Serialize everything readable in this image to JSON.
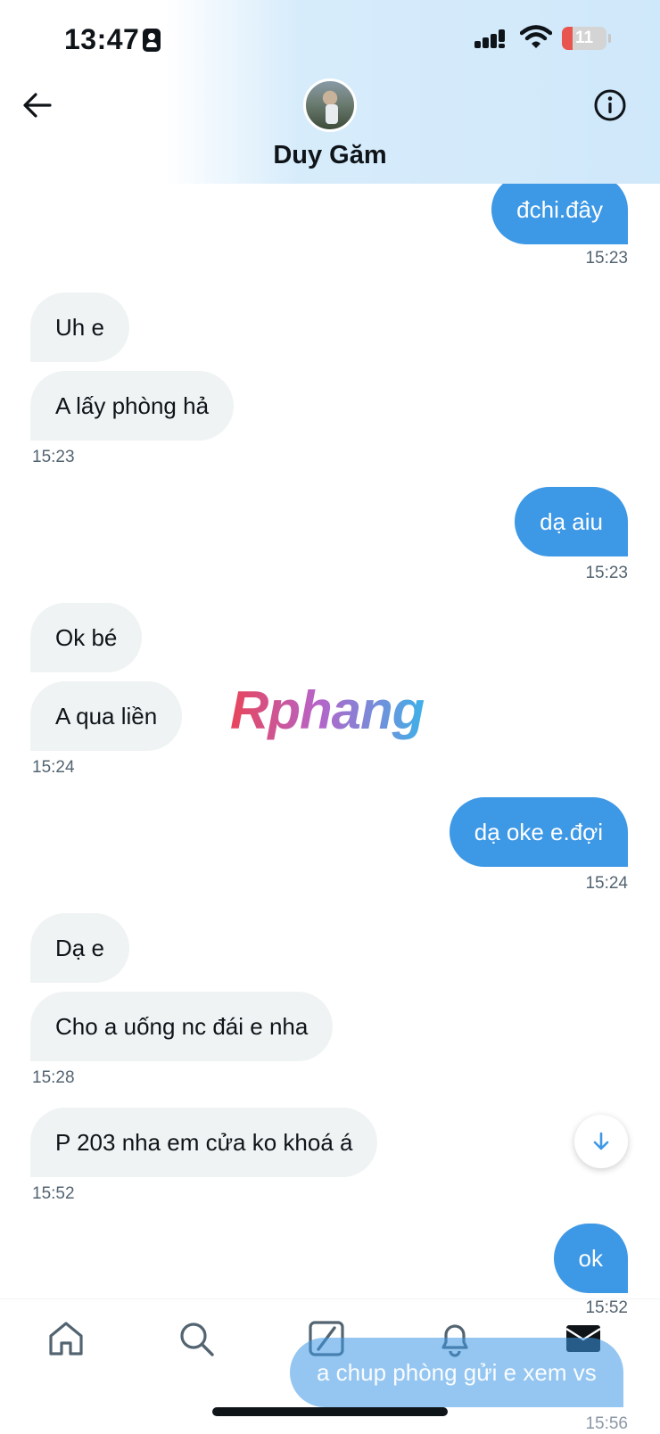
{
  "status_bar": {
    "time": "13:47",
    "battery": "11",
    "battery_level": 0.11
  },
  "header": {
    "contact_name": "Duy Găm"
  },
  "messages": [
    {
      "text": "đchi.đây"
    },
    {
      "text": "15:23"
    },
    {
      "text": "Uh e"
    },
    {
      "text": "A lấy phòng hả"
    },
    {
      "text": "15:23"
    },
    {
      "text": "dạ aiu"
    },
    {
      "text": "15:23"
    },
    {
      "text": "Ok bé"
    },
    {
      "text": "A qua liền"
    },
    {
      "text": "15:24"
    },
    {
      "text": "dạ oke e.đợi"
    },
    {
      "text": "15:24"
    },
    {
      "text": "Dạ e"
    },
    {
      "text": "Cho a uống nc đái e nha"
    },
    {
      "text": "15:28"
    },
    {
      "text": "P 203 nha em cửa ko khoá á"
    },
    {
      "text": "15:52"
    },
    {
      "text": "ok"
    },
    {
      "text": "15:52"
    },
    {
      "text": "a chup phòng gửi e xem vs"
    },
    {
      "text": "15:56"
    }
  ],
  "watermark": "Rphang",
  "tabs": [
    {
      "icon": "home-icon"
    },
    {
      "icon": "search-icon"
    },
    {
      "icon": "grok-icon"
    },
    {
      "icon": "bell-icon"
    },
    {
      "icon": "mail-icon"
    }
  ],
  "colors": {
    "outgoing": "#3d98e5",
    "incoming": "#eff3f4",
    "text": "#0f1419",
    "muted": "#536471"
  }
}
